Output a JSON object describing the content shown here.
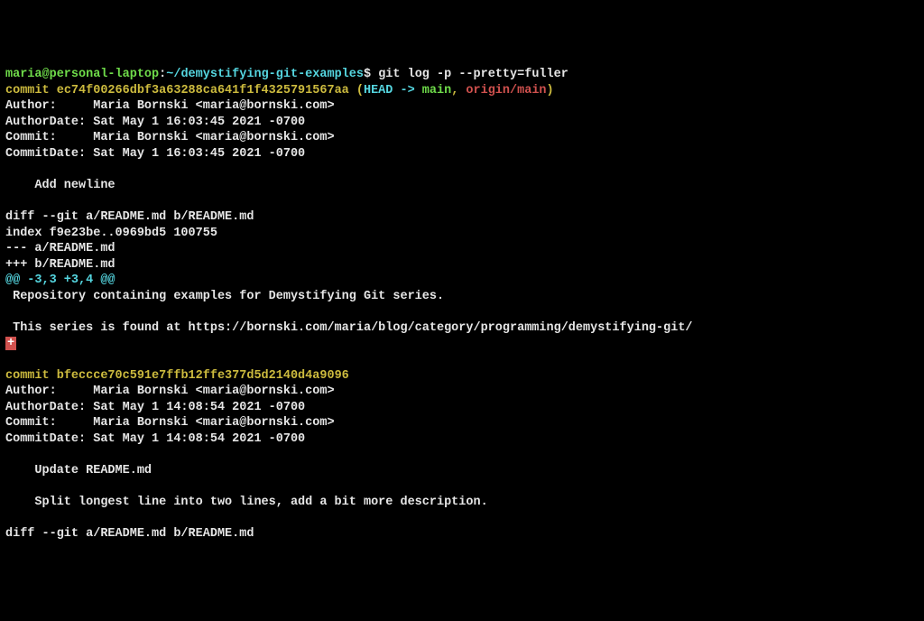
{
  "prompt": {
    "user": "maria@personal-laptop",
    "colon": ":",
    "path": "~/demystifying-git-examples",
    "dollar": "$ ",
    "command": "git log -p --pretty=fuller"
  },
  "c1": {
    "prefix": "commit ",
    "hash": "ec74f00266dbf3a63288ca641f1f4325791567aa ",
    "lparen": "(",
    "head": "HEAD -> ",
    "main": "main",
    "comma": ", ",
    "origin": "origin/main",
    "rparen": ")",
    "author": "Author:     Maria Bornski <maria@bornski.com>",
    "authordate": "AuthorDate: Sat May 1 16:03:45 2021 -0700",
    "commit": "Commit:     Maria Bornski <maria@bornski.com>",
    "commitdate": "CommitDate: Sat May 1 16:03:45 2021 -0700",
    "msg": "    Add newline",
    "diffcmd": "diff --git a/README.md b/README.md",
    "indexline": "index f9e23be..0969bd5 100755",
    "minusfile": "--- a/README.md",
    "plusfile": "+++ b/README.md",
    "hunk": "@@ -3,3 +3,4 @@",
    "ctx1": " Repository containing examples for Demystifying Git series.",
    "ctx2": " This series is found at https://bornski.com/maria/blog/category/programming/demystifying-git/",
    "addline": "+"
  },
  "c2": {
    "prefix": "commit ",
    "hash": "bfeccce70c591e7ffb12ffe377d5d2140d4a9096",
    "author": "Author:     Maria Bornski <maria@bornski.com>",
    "authordate": "AuthorDate: Sat May 1 14:08:54 2021 -0700",
    "commit": "Commit:     Maria Bornski <maria@bornski.com>",
    "commitdate": "CommitDate: Sat May 1 14:08:54 2021 -0700",
    "msg1": "    Update README.md",
    "msg2": "    Split longest line into two lines, add a bit more description.",
    "diffcmd": "diff --git a/README.md b/README.md"
  }
}
